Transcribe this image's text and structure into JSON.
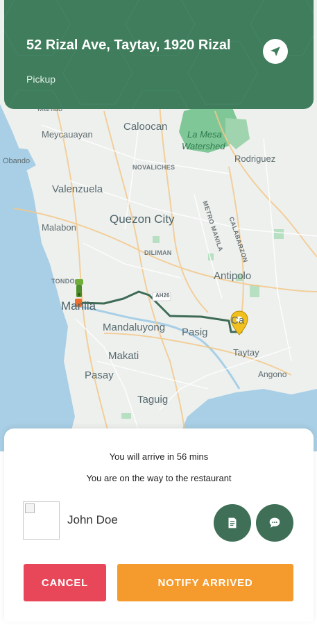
{
  "header": {
    "address": "52 Rizal Ave, Taytay, 1920 Rizal",
    "subtitle": "Pickup"
  },
  "map": {
    "labels": {
      "manila_top": "Manlao",
      "meycauayan": "Meycauayan",
      "caloocan": "Caloocan",
      "la_mesa_1": "La Mesa",
      "la_mesa_2": "Watershed",
      "obando": "Obando",
      "novaliches": "NOVALICHES",
      "rodriguez": "Rodriguez",
      "valenzuela": "Valenzuela",
      "calabarzon": "CALABARZON",
      "metro_manila": "METRO MANILA",
      "malabon": "Malabon",
      "quezon_city": "Quezon City",
      "diliman": "DILIMAN",
      "antipolo": "Antipolo",
      "tondo": "TONDO",
      "manila": "Manila",
      "ah26": "AH26",
      "cainta": "Ca",
      "mandaluyong": "Mandaluyong",
      "pasig": "Pasig",
      "taytay": "Taytay",
      "makati": "Makati",
      "angono": "Angono",
      "pasay": "Pasay",
      "taguig": "Taguig"
    }
  },
  "trip": {
    "eta_text": "You will arrive in 56 mins",
    "status_text": "You are on the way to the restaurant"
  },
  "driver": {
    "name": "John Doe"
  },
  "actions": {
    "cancel_label": "CANCEL",
    "notify_label": "NOTIFY ARRIVED"
  },
  "colors": {
    "header_green": "#3f7d5c",
    "action_green": "#3f6f57",
    "cancel_red": "#e8475a",
    "notify_orange": "#f59a2c",
    "route_green": "#3d6b56",
    "pin_yellow": "#f2c01e"
  },
  "icons": {
    "navigate": "navigation-arrow-icon",
    "documents": "document-icon",
    "chat": "chat-bubble-icon",
    "destination": "location-pin-icon",
    "rider": "rider-icon"
  }
}
